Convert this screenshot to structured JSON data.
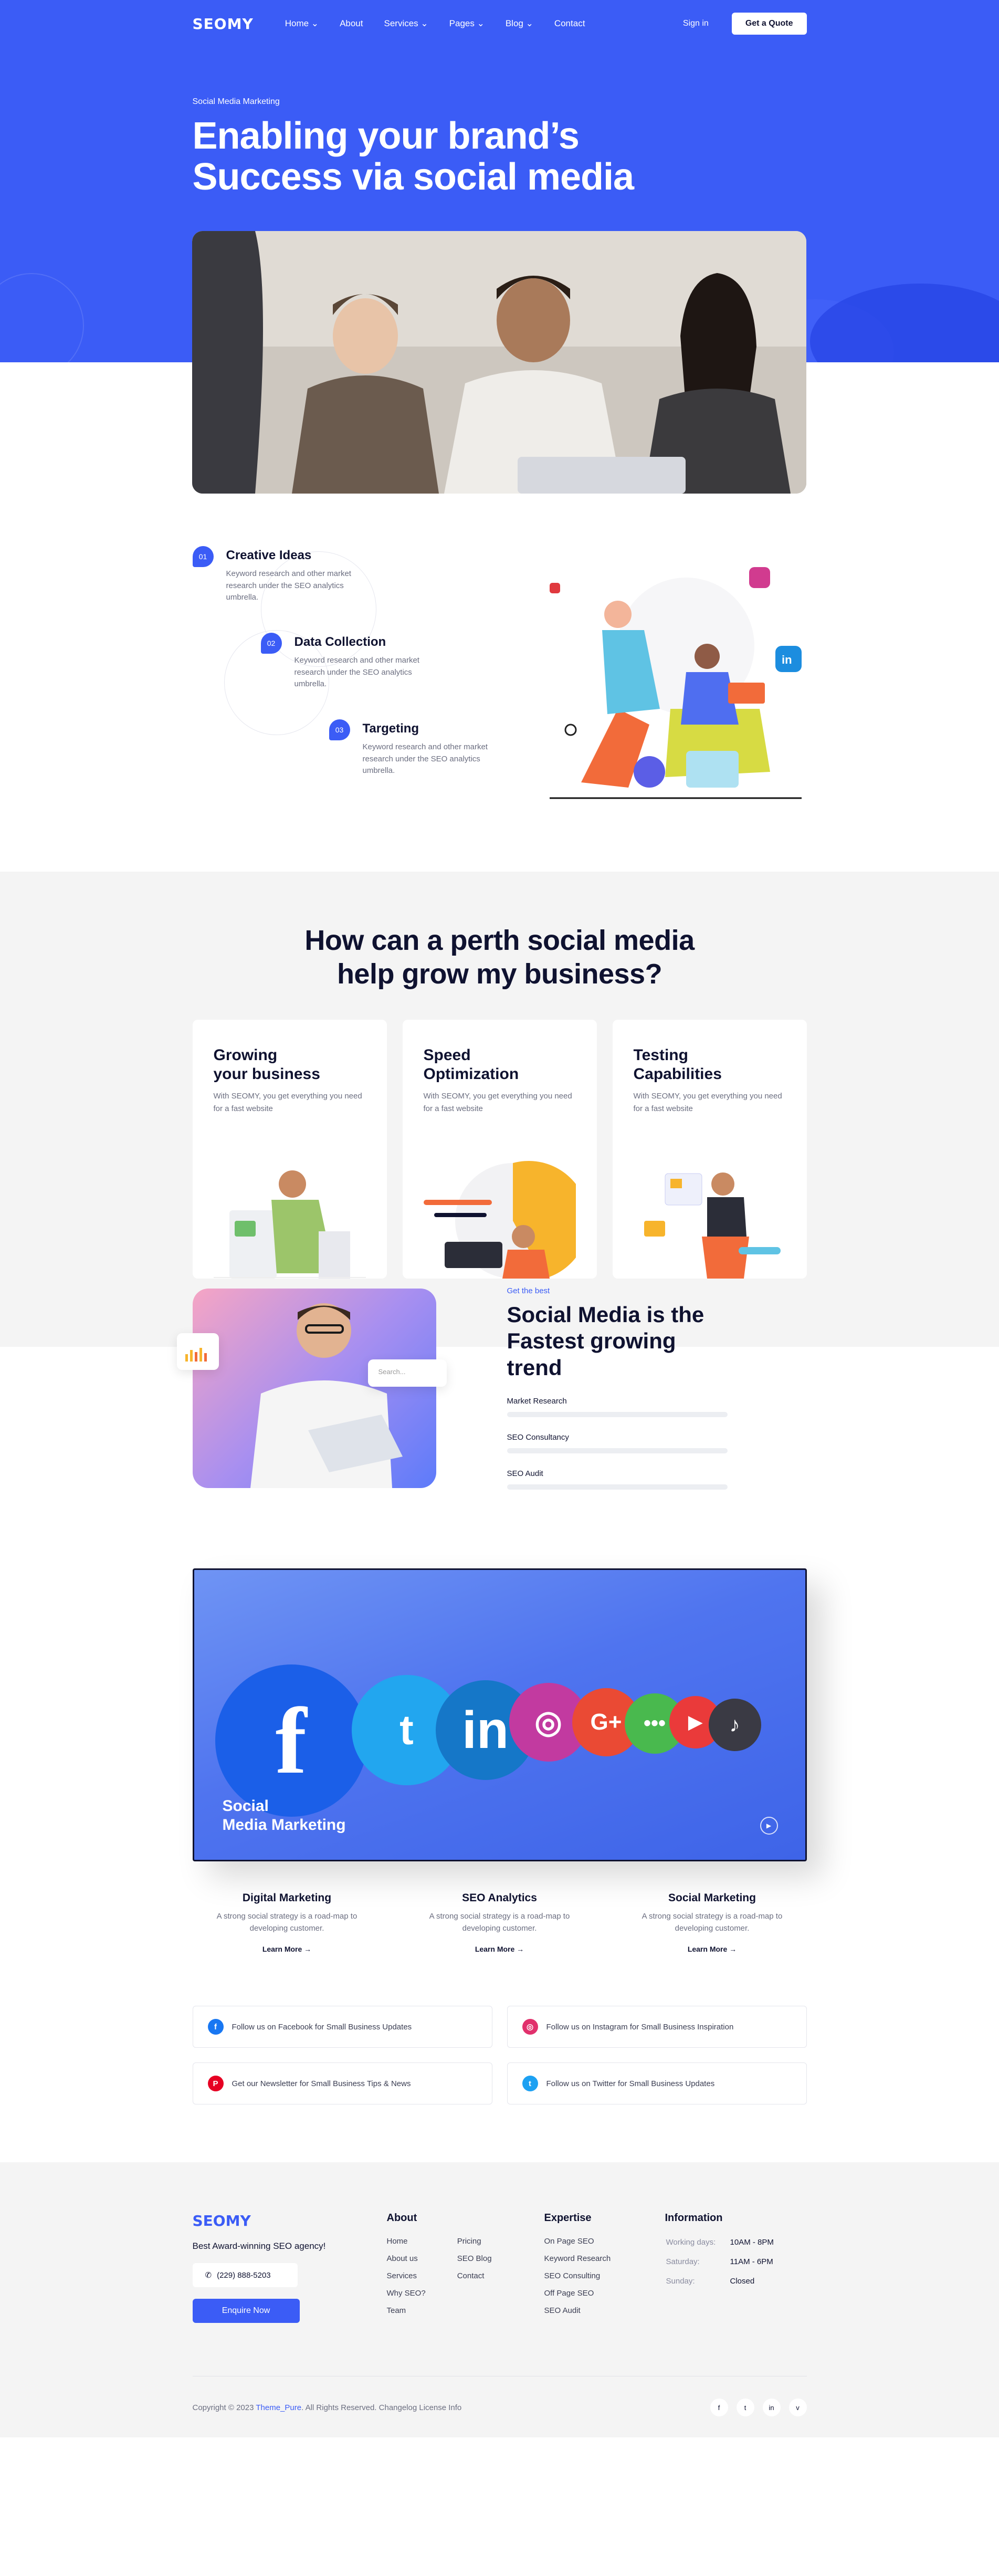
{
  "nav": {
    "logo": "SEOMY",
    "items": [
      "Home ⌄",
      "About",
      "Services ⌄",
      "Pages ⌄",
      "Blog ⌄",
      "Contact"
    ],
    "signin": "Sign in",
    "quote": "Get a Quote"
  },
  "hero": {
    "eyebrow": "Social Media Marketing",
    "title_line1": "Enabling your brand’s",
    "title_line2": "Success via social media"
  },
  "features": [
    {
      "num": "01",
      "title": "Creative Ideas",
      "desc": "Keyword research and other market research under the SEO analytics umbrella."
    },
    {
      "num": "02",
      "title": "Data Collection",
      "desc": "Keyword research and other market research under the SEO analytics umbrella."
    },
    {
      "num": "03",
      "title": "Targeting",
      "desc": "Keyword research and other market research under the SEO analytics umbrella."
    }
  ],
  "how": {
    "title_line1": "How can a perth social media",
    "title_line2": "help grow my business?",
    "cards": [
      {
        "title_line1": "Growing",
        "title_line2": "your business",
        "desc": "With SEOMY, you get everything you need for a fast website"
      },
      {
        "title_line1": "Speed",
        "title_line2": "Optimization",
        "desc": "With SEOMY, you get everything you need for a fast website"
      },
      {
        "title_line1": "Testing",
        "title_line2": "Capabilities",
        "desc": "With SEOMY, you get everything you need for a fast website"
      }
    ]
  },
  "trend": {
    "eyebrow": "Get the best",
    "title_line1": "Social Media is the",
    "title_line2": "Fastest growing trend",
    "search_placeholder": "Search...",
    "skills": [
      "Market Research",
      "SEO Consultancy",
      "SEO Audit"
    ]
  },
  "video": {
    "caption_line1": "Social",
    "caption_line2": "Media Marketing",
    "icons": [
      "facebook-icon",
      "twitter-icon",
      "linkedin-icon",
      "instagram-icon",
      "google-plus-icon",
      "chat-icon",
      "youtube-icon",
      "tiktok-icon"
    ]
  },
  "services": [
    {
      "title": "Digital Marketing",
      "desc": "A strong social strategy is a road-map to developing customer.",
      "link": "Learn More →"
    },
    {
      "title": "SEO Analytics",
      "desc": "A strong social strategy is a road-map to developing customer.",
      "link": "Learn More →"
    },
    {
      "title": "Social Marketing",
      "desc": "A strong social strategy is a road-map to developing customer.",
      "link": "Learn More →"
    }
  ],
  "follow": [
    {
      "icon": "facebook-icon",
      "glyph": "f",
      "color": "#1877f2",
      "text": "Follow us on Facebook for Small Business Updates"
    },
    {
      "icon": "instagram-icon",
      "glyph": "◎",
      "color": "#e1306c",
      "text": "Follow us on Instagram for Small Business Inspiration"
    },
    {
      "icon": "pinterest-icon",
      "glyph": "P",
      "color": "#e60023",
      "text": "Get our Newsletter for Small Business Tips & News"
    },
    {
      "icon": "twitter-icon",
      "glyph": "t",
      "color": "#1da1f2",
      "text": "Follow us on Twitter for Small Business Updates"
    }
  ],
  "footer": {
    "logo": "SEOMY",
    "tagline": "Best Award-winning SEO agency!",
    "phone": "(229) 888-5203",
    "enquire": "Enquire Now",
    "about_title": "About",
    "about_col1": [
      "Home",
      "About us",
      "Services",
      "Why SEO?",
      "Team"
    ],
    "about_col2": [
      "Pricing",
      "SEO Blog",
      "Contact"
    ],
    "expertise_title": "Expertise",
    "expertise": [
      "On Page SEO",
      "Keyword Research",
      "SEO Consulting",
      "Off Page SEO",
      "SEO Audit"
    ],
    "info_title": "Information",
    "hours": [
      {
        "day": "Working days:",
        "time": "10AM - 8PM"
      },
      {
        "day": "Saturday:",
        "time": "11AM - 6PM"
      },
      {
        "day": "Sunday:",
        "time": "Closed"
      }
    ],
    "copy_prefix": "Copyright © 2023 ",
    "copy_brand": "Theme_Pure",
    "copy_suffix": ". All Rights Reserved. Changelog License Info",
    "socials": [
      "f",
      "t",
      "in",
      "v"
    ]
  },
  "colors": {
    "primary": "#3b5cf6",
    "dark": "#0f1230",
    "muted": "#6b6e80",
    "light_bg": "#f4f4f4"
  }
}
